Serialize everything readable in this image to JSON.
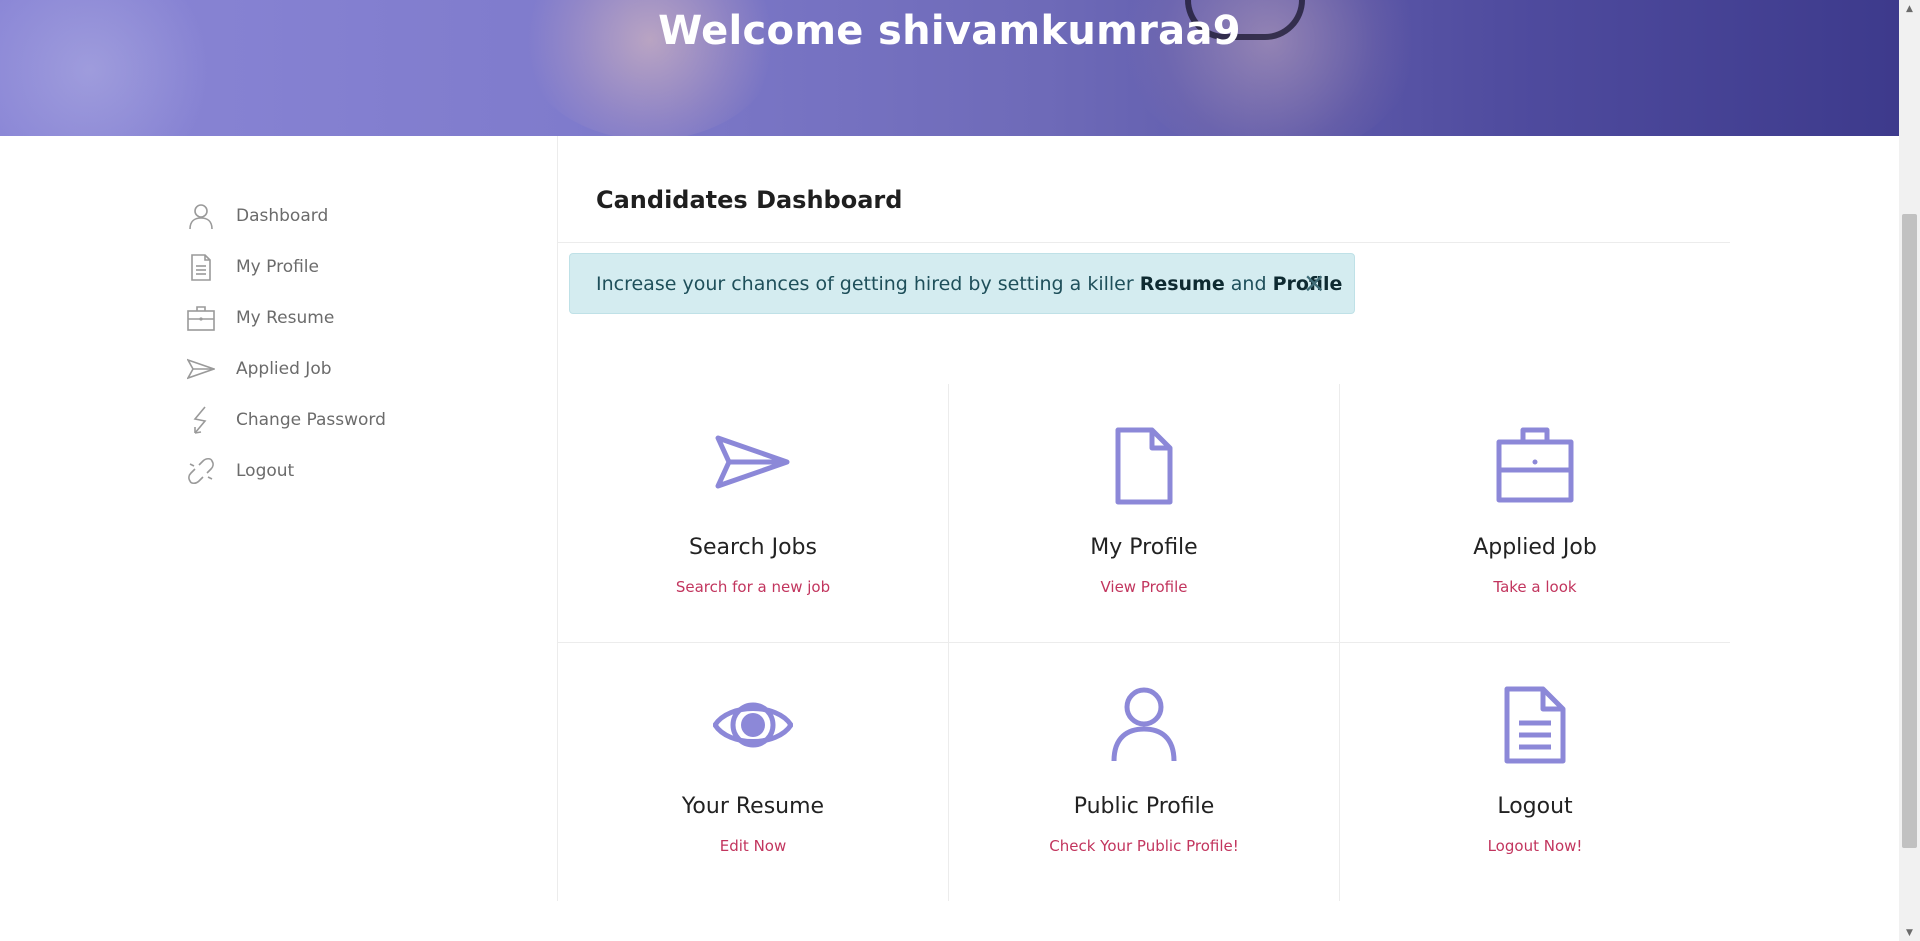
{
  "header": {
    "title": "Welcome shivamkumraa9"
  },
  "sidebar": {
    "items": [
      {
        "label": "Dashboard",
        "icon": "user-icon"
      },
      {
        "label": "My Profile",
        "icon": "document-icon"
      },
      {
        "label": "My Resume",
        "icon": "briefcase-icon"
      },
      {
        "label": "Applied Job",
        "icon": "paper-plane-icon"
      },
      {
        "label": "Change Password",
        "icon": "lightning-icon"
      },
      {
        "label": "Logout",
        "icon": "broken-link-icon"
      }
    ]
  },
  "main": {
    "title": "Candidates Dashboard",
    "alert": {
      "prefix": "Increase your chances of getting hired by setting a killer ",
      "bold1": "Resume",
      "middle": " and ",
      "bold2": "Profile",
      "close": "×"
    },
    "cards": [
      {
        "title": "Search Jobs",
        "link": "Search for a new job",
        "icon": "paper-plane-icon"
      },
      {
        "title": "My Profile",
        "link": "View Profile",
        "icon": "document-icon"
      },
      {
        "title": "Applied Job",
        "link": "Take a look",
        "icon": "briefcase-icon"
      },
      {
        "title": "Your Resume",
        "link": "Edit Now",
        "icon": "eye-icon"
      },
      {
        "title": "Public Profile",
        "link": "Check Your Public Profile!",
        "icon": "user-icon"
      },
      {
        "title": "Logout",
        "link": "Logout Now!",
        "icon": "file-text-icon"
      }
    ]
  },
  "colors": {
    "accent": "#8c88d8",
    "link": "#c2355e",
    "alert_bg": "#d4ecf0"
  }
}
